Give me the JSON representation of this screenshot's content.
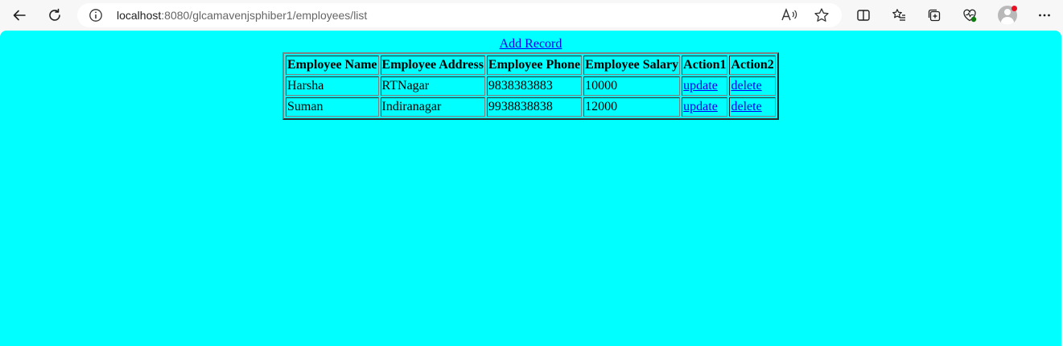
{
  "browser": {
    "url_host": "localhost",
    "url_rest": ":8080/glcamavenjsphiber1/employees/list"
  },
  "page": {
    "add_link": "Add Record",
    "headers": [
      "Employee Name",
      "Employee Address",
      "Employee Phone",
      "Employee Salary",
      "Action1",
      "Action2"
    ],
    "rows": [
      {
        "name": "Harsha",
        "address": "RTNagar",
        "phone": "9838383883",
        "salary": "10000",
        "action1": "update",
        "action2": "delete"
      },
      {
        "name": "Suman",
        "address": "Indiranagar",
        "phone": "9938838838",
        "salary": "12000",
        "action1": "update",
        "action2": "delete"
      }
    ]
  },
  "colors": {
    "page_background": "#00ffff",
    "link": "#0000ee",
    "notification_dot": "#e81123"
  }
}
